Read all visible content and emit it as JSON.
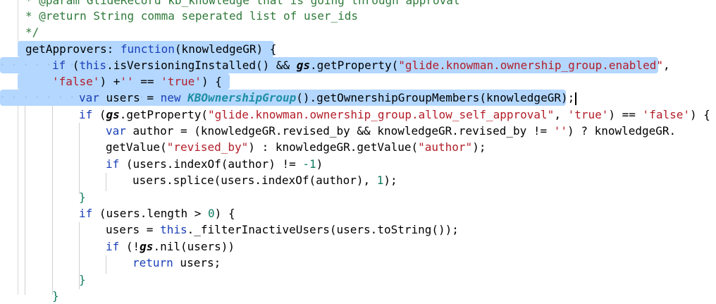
{
  "editor": {
    "lines": [
      {
        "id": "l0",
        "text": "* @param GlideRecord kb_knowledge that is going through approval"
      },
      {
        "id": "l1",
        "text": "* @return String comma seperated list of user_ids"
      },
      {
        "id": "l2",
        "text": "*/"
      },
      {
        "id": "l3",
        "text": "getApprovers: function(knowledgeGR) {"
      },
      {
        "id": "l4",
        "text": "if (this.isVersioningInstalled() && gs.getProperty(\"glide.knowman.ownership_group.enabled\","
      },
      {
        "id": "l5",
        "text": "'false') +'' == 'true') {"
      },
      {
        "id": "l6",
        "text": "var users = new KBOwnershipGroup().getOwnershipGroupMembers(knowledgeGR);"
      },
      {
        "id": "l7",
        "text": "if (gs.getProperty(\"glide.knowman.ownership_group.allow_self_approval\", 'true') == 'false') {"
      },
      {
        "id": "l8",
        "text": "var author = (knowledgeGR.revised_by && knowledgeGR.revised_by != '') ? knowledgeGR."
      },
      {
        "id": "l9",
        "text": "getValue(\"revised_by\") : knowledgeGR.getValue(\"author\");"
      },
      {
        "id": "l10",
        "text": "if (users.indexOf(author) != -1)"
      },
      {
        "id": "l11",
        "text": "users.splice(users.indexOf(author), 1);"
      },
      {
        "id": "l12",
        "text": "}"
      },
      {
        "id": "l13",
        "text": "if (users.length > 0) {"
      },
      {
        "id": "l14",
        "text": "users = this._filterInactiveUsers(users.toString());"
      },
      {
        "id": "l15",
        "text": "if (!gs.nil(users))"
      },
      {
        "id": "l16",
        "text": "return users;"
      },
      {
        "id": "l17",
        "text": "}"
      },
      {
        "id": "l18",
        "text": "}"
      }
    ]
  }
}
